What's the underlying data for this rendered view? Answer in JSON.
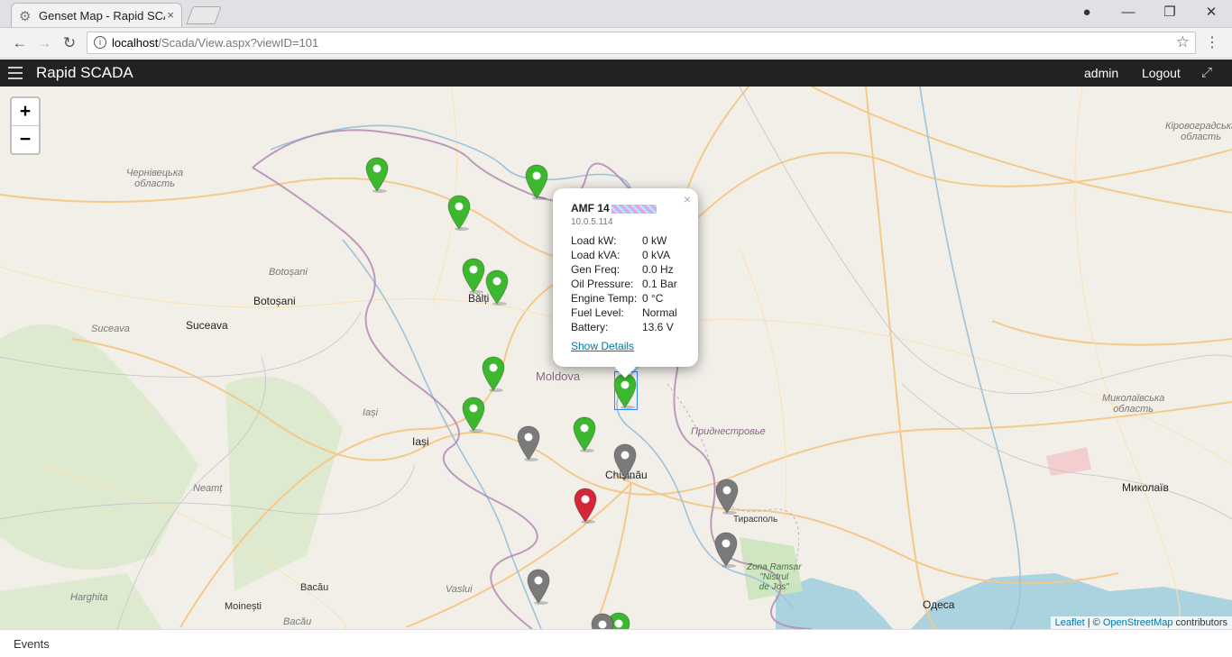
{
  "browser": {
    "tab_title": "Genset Map - Rapid SCADA",
    "tab_close": "×",
    "url_host": "localhost",
    "url_path": "/Scada/View.aspx?viewID=101"
  },
  "app": {
    "brand": "Rapid SCADA",
    "user": "admin",
    "logout": "Logout"
  },
  "map": {
    "zoom_in": "+",
    "zoom_out": "−",
    "labels": {
      "chernivtsi": "Чернівецька\nобласть",
      "kirovohrad": "Кіровоградська\nобласть",
      "botosani_region": "Botoșani",
      "botosani_city": "Botoșani",
      "suceava_city": "Suceava",
      "suceava_region": "Suceava",
      "balti": "Bălți",
      "moldova": "Moldova",
      "iasi_region": "Iași",
      "iasi_city": "Iași",
      "neamt": "Neamț",
      "chisinau": "Chișinău",
      "pridnestrovie": "Приднестровье",
      "tiraspol": "Тирасполь",
      "mykolaiv_region": "Миколаївська\nобласть",
      "mykolaiv": "Миколаїв",
      "ramsar": "Zona Ramsar\n\"Nistrul\nde Jos\"",
      "odesa": "Одеса",
      "harghita": "Harghita",
      "moinesti": "Moinești",
      "bacau_city": "Bacău",
      "bacau_region": "Bacău",
      "vaslui": "Vaslui"
    },
    "markers": [
      {
        "color": "green"
      },
      {
        "color": "green"
      },
      {
        "color": "green"
      },
      {
        "color": "green"
      },
      {
        "color": "green"
      },
      {
        "color": "green"
      },
      {
        "color": "green"
      },
      {
        "color": "green"
      },
      {
        "color": "green"
      },
      {
        "color": "green"
      },
      {
        "color": "grey"
      },
      {
        "color": "grey"
      },
      {
        "color": "red"
      },
      {
        "color": "grey"
      },
      {
        "color": "grey"
      },
      {
        "color": "grey"
      },
      {
        "color": "grey"
      }
    ],
    "colors": {
      "green": "#3bb82e",
      "grey": "#7a7a7a",
      "red": "#d4283a"
    },
    "attribution_leaflet": "Leaflet",
    "attribution_sep": " | © ",
    "attribution_osm": "OpenStreetMap",
    "attribution_rest": " contributors"
  },
  "popup": {
    "close": "×",
    "title": "AMF 14",
    "ip": "10.0.5.114",
    "rows": [
      {
        "label": "Load kW:",
        "value": "0 kW"
      },
      {
        "label": "Load kVA:",
        "value": "0 kVA"
      },
      {
        "label": "Gen Freq:",
        "value": "0.0 Hz"
      },
      {
        "label": "Oil Pressure:",
        "value": "0.1 Bar"
      },
      {
        "label": "Engine Temp:",
        "value": "0 °C"
      },
      {
        "label": "Fuel Level:",
        "value": "Normal"
      },
      {
        "label": "Battery:",
        "value": "13.6 V"
      }
    ],
    "details": "Show Details"
  },
  "footer": {
    "events": "Events"
  }
}
